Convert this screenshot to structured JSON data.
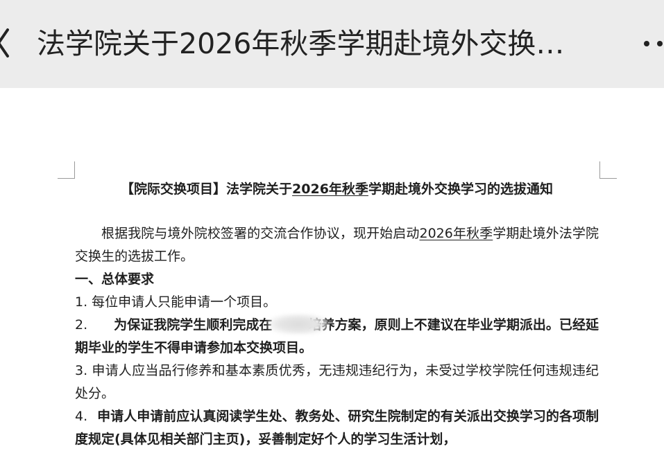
{
  "header": {
    "title": "法学院关于2026年秋季学期赴境外交换…",
    "back_icon": "chevron-left-icon",
    "more_icon": "more-horizontal-icon"
  },
  "document": {
    "title_pre": "【院际交换项目】法学院关于",
    "title_underlined": "2026年秋季",
    "title_post": "学期赴境外交换学习的选拔通知",
    "intro_pre": "根据我院与境外院校签署的交流合作协议，现开始启动",
    "intro_underlined": "2026年秋季",
    "intro_post": "学期赴境外法学院交换生的选拔工作。",
    "section1_heading": "一、总体要求",
    "item1": "1. 每位申请人只能申请一个项目。",
    "item2_num": "2.",
    "item2_text_a": "为保证我院学生顺利完成在",
    "item2_text_b": "培养方案，原则上不建议在毕业学期派出。已经延期毕业的学生不得申请参加本交换项目。",
    "item3": "3. 申请人应当品行修养和基本素质优秀，无违规违纪行为，未受过学校学院任何违规违纪处分。",
    "item4_num": "4.",
    "item4_text": "申请人申请前应认真阅读学生处、教务处、研究生院制定的有关派出交换学习的各项制度规定(具体见相关部门主页)，妥善制定好个人的学习生活计划，"
  }
}
